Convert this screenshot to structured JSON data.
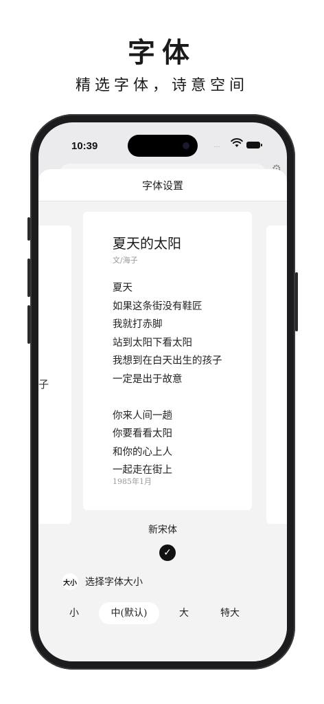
{
  "promo": {
    "title": "字体",
    "subtitle": "精选字体，诗意空间"
  },
  "status_bar": {
    "time": "10:39",
    "signal": "····"
  },
  "sheet": {
    "title": "字体设置"
  },
  "preview": {
    "poem_title": "夏天的太阳",
    "author": "文/海子",
    "stanza1": [
      "夏天",
      "如果这条街没有鞋匠",
      "我就打赤脚",
      "站到太阳下看太阳",
      "我想到在白天出生的孩子",
      "一定是出于故意"
    ],
    "stanza2": [
      "你来人间一趟",
      "你要看看太阳",
      "和你的心上人",
      "一起走在街上"
    ],
    "date": "1985年1月",
    "left_peek_char": "子"
  },
  "font": {
    "name": "新宋体",
    "selected_mark": "✓"
  },
  "size": {
    "icon_text": "大小",
    "label": "选择字体大小",
    "options": [
      "小",
      "中(默认)",
      "大",
      "特大"
    ],
    "selected_index": 1
  },
  "icons": {
    "wifi": "wifi-icon",
    "battery": "battery-icon",
    "gear": "gear-icon",
    "check": "check-icon"
  }
}
